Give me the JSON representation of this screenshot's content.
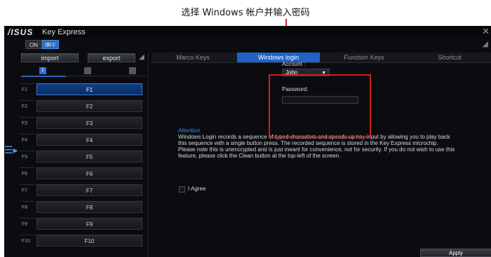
{
  "annotation": {
    "caption": "选择 Windows 帐户并输入密码"
  },
  "window": {
    "logo": "/ISUS",
    "title": "Key Express"
  },
  "power_toggle": {
    "on_label": "ON",
    "off_label": "OFF",
    "state": "OFF"
  },
  "left_panel": {
    "import_label": "import",
    "export_label": "export",
    "profiles": [
      {
        "label": "1",
        "active": true
      },
      {
        "label": "",
        "active": false
      },
      {
        "label": "",
        "active": false
      }
    ],
    "keys": [
      {
        "label": "F1",
        "button": "F1",
        "selected": true
      },
      {
        "label": "F2",
        "button": "F2",
        "selected": false
      },
      {
        "label": "F3",
        "button": "F3",
        "selected": false
      },
      {
        "label": "F4",
        "button": "F4",
        "selected": false
      },
      {
        "label": "F5",
        "button": "F5",
        "selected": false
      },
      {
        "label": "F6",
        "button": "F6",
        "selected": false
      },
      {
        "label": "F7",
        "button": "F7",
        "selected": false
      },
      {
        "label": "F8",
        "button": "F8",
        "selected": false
      },
      {
        "label": "F9",
        "button": "F9",
        "selected": false
      },
      {
        "label": "F10",
        "button": "F10",
        "selected": false
      }
    ]
  },
  "tabs": [
    {
      "label": "Marco Keys",
      "active": false
    },
    {
      "label": "Windows login",
      "active": true
    },
    {
      "label": "Function Keys",
      "active": false
    },
    {
      "label": "Shortcut",
      "active": false
    }
  ],
  "login_form": {
    "account_label": "Account :",
    "account_value": "John",
    "password_label": "Password:",
    "password_value": ""
  },
  "attention": {
    "title": "Attention",
    "body": "Windows Login records a sequence of typed characters and speeds up key input by allowing you to play back this sequence with a single button press. The recorded sequence is stored in the Key Express microchip. Please note this is unencrypted and is just meant for convenience, not for security. If you do not wish to use this feature, please click the Clean button at the top-left of the screen."
  },
  "agree": {
    "label": "I Agree",
    "checked": false
  },
  "apply_label": "Apply",
  "colors": {
    "accent": "#1f63c6",
    "highlight": "#d21f1f",
    "attention": "#3a8ee8"
  }
}
